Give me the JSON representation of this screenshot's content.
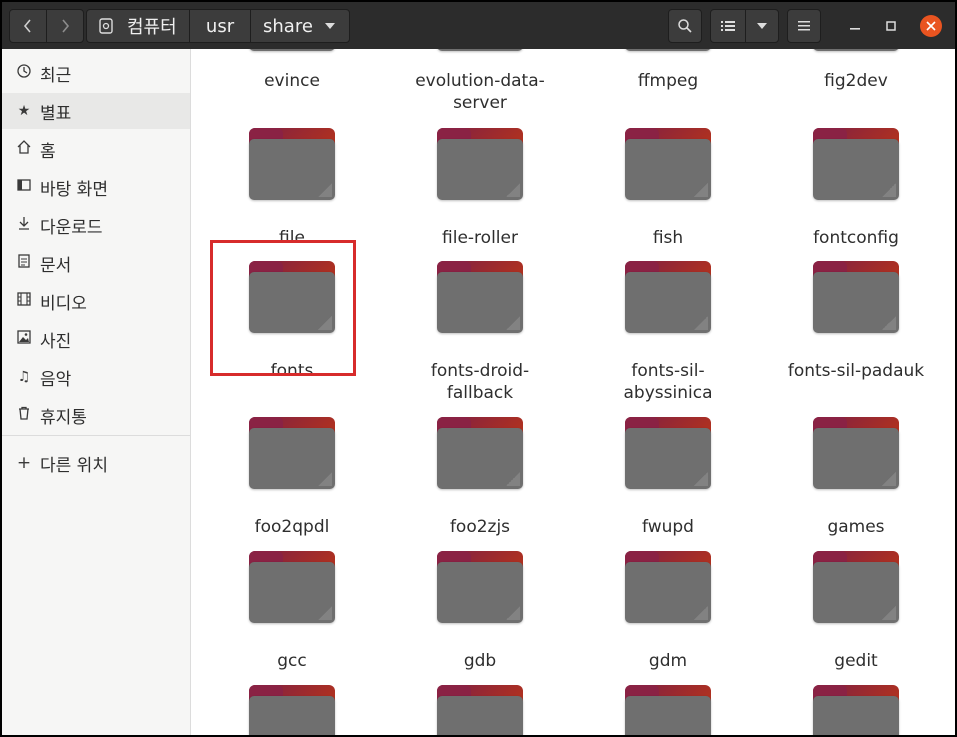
{
  "path": {
    "crumbs": [
      "컴퓨터",
      "usr",
      "share"
    ]
  },
  "sidebar": {
    "items": [
      {
        "label": "최근",
        "icon": "clock-icon"
      },
      {
        "label": "별표",
        "icon": "star-icon"
      },
      {
        "label": "홈",
        "icon": "home-icon"
      },
      {
        "label": "바탕 화면",
        "icon": "desktop-icon"
      },
      {
        "label": "다운로드",
        "icon": "download-icon"
      },
      {
        "label": "문서",
        "icon": "document-icon"
      },
      {
        "label": "비디오",
        "icon": "video-icon"
      },
      {
        "label": "사진",
        "icon": "image-icon"
      },
      {
        "label": "음악",
        "icon": "music-icon"
      },
      {
        "label": "휴지통",
        "icon": "trash-icon"
      }
    ],
    "other_locations": "다른 위치"
  },
  "files": [
    {
      "name": "evince"
    },
    {
      "name": "evolution-data-server"
    },
    {
      "name": "ffmpeg"
    },
    {
      "name": "fig2dev"
    },
    {
      "name": "file"
    },
    {
      "name": "file-roller"
    },
    {
      "name": "fish"
    },
    {
      "name": "fontconfig"
    },
    {
      "name": "fonts",
      "selected": true
    },
    {
      "name": "fonts-droid-fallback"
    },
    {
      "name": "fonts-sil-abyssinica"
    },
    {
      "name": "fonts-sil-padauk"
    },
    {
      "name": "foo2qpdl"
    },
    {
      "name": "foo2zjs"
    },
    {
      "name": "fwupd"
    },
    {
      "name": "games"
    },
    {
      "name": "gcc"
    },
    {
      "name": "gdb"
    },
    {
      "name": "gdm"
    },
    {
      "name": "gedit"
    }
  ],
  "colors": {
    "headerbar": "#2c2c2c",
    "highlight": "#d72b2b",
    "close_button": "#e95420"
  }
}
